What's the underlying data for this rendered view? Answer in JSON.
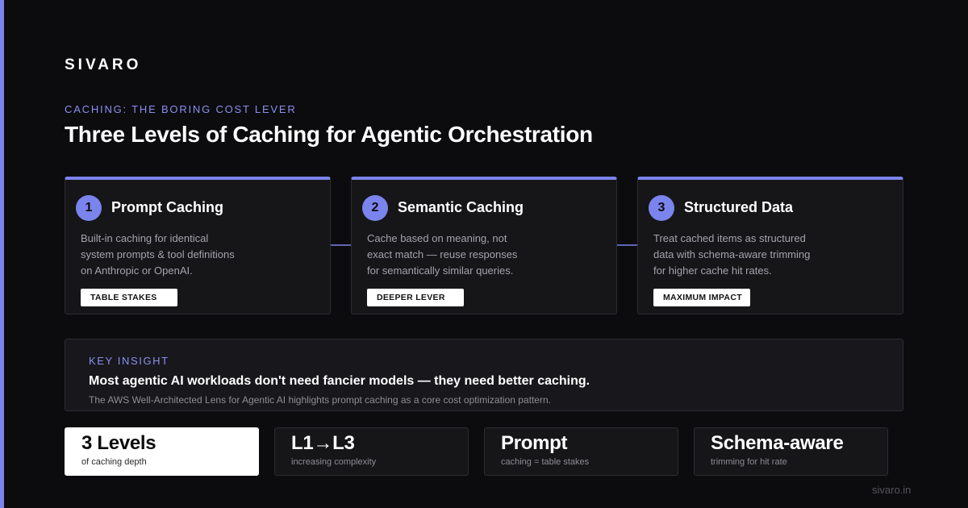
{
  "colors": {
    "accent": "#7b83ec",
    "background": "#0c0c0e",
    "card": "#161619",
    "border": "#2c2c31"
  },
  "brand": "SIVARO",
  "header": {
    "eyebrow": "CACHING: THE BORING COST LEVER",
    "title": "Three Levels of Caching for Agentic Orchestration"
  },
  "cards": [
    {
      "number": "1",
      "title": "Prompt Caching",
      "desc": [
        "Built-in caching for identical",
        "system prompts & tool definitions",
        "on Anthropic or OpenAI."
      ],
      "badge": "TABLE STAKES"
    },
    {
      "number": "2",
      "title": "Semantic Caching",
      "desc": [
        "Cache based on meaning, not",
        "exact match — reuse responses",
        "for semantically similar queries."
      ],
      "badge": "DEEPER LEVER"
    },
    {
      "number": "3",
      "title": "Structured Data",
      "desc": [
        "Treat cached items as structured",
        "data with schema-aware trimming",
        "for higher cache hit rates."
      ],
      "badge": "MAXIMUM IMPACT"
    }
  ],
  "insight": {
    "label": "KEY INSIGHT",
    "headline": "Most agentic AI workloads don't need fancier models — they need better caching.",
    "note": "The AWS Well-Architected Lens for Agentic AI highlights prompt caching as a core cost optimization pattern."
  },
  "stats": [
    {
      "value": "3 Levels",
      "label": "of caching depth"
    },
    {
      "value": "L1→L3",
      "label": "increasing complexity"
    },
    {
      "value": "Prompt",
      "label": "caching = table stakes"
    },
    {
      "value": "Schema-aware",
      "label": "trimming for hit rate"
    }
  ],
  "footer": {
    "url": "sivaro.in"
  },
  "icons": {
    "connector": "arrow-right-icon"
  }
}
